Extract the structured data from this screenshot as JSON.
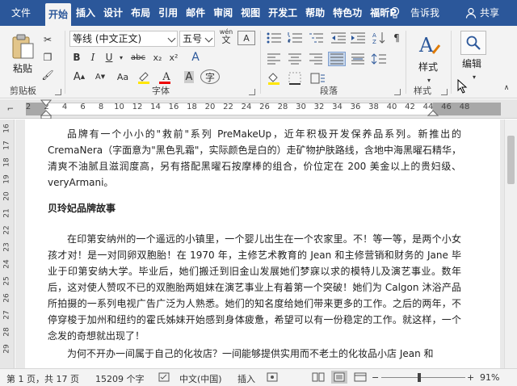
{
  "tabs": [
    "文件",
    "开始",
    "插入",
    "设计",
    "布局",
    "引用",
    "邮件",
    "审阅",
    "视图",
    "开发工",
    "帮助",
    "特色功",
    "福昕P"
  ],
  "active_tab": "开始",
  "tab_right": {
    "tellme": "告诉我",
    "share": "共享"
  },
  "clipboard": {
    "paste": "粘贴",
    "label": "剪贴板"
  },
  "font": {
    "name": "等线 (中文正文)",
    "size": "五号",
    "wen": "wén",
    "label": "字体",
    "bold": "B",
    "italic": "I",
    "underline": "U",
    "strike": "abc",
    "sub": "x₂",
    "sup": "x²",
    "font_color_a": "A",
    "aa_big": "A",
    "aa_small": "A",
    "aa": "Aa",
    "char": "A",
    "circ": "字",
    "clear": "A"
  },
  "paragraph": {
    "label": "段落"
  },
  "styles": {
    "button": "样式",
    "label": "样式"
  },
  "editing": {
    "button": "编辑"
  },
  "ruler": {
    "numbers": [
      "2",
      "2",
      "4",
      "6",
      "8",
      "10",
      "12",
      "14",
      "16",
      "18",
      "20",
      "22",
      "24",
      "26",
      "28",
      "30",
      "32",
      "34",
      "36",
      "38",
      "40",
      "42",
      "44",
      "46",
      "48"
    ]
  },
  "vruler": {
    "numbers": [
      "16",
      "17",
      "18",
      "19",
      "20",
      "21",
      "22",
      "23",
      "24",
      "25",
      "26",
      "27",
      "28",
      "29"
    ]
  },
  "document": {
    "p1": "品牌有一个小小的\"救前\"系列 PreMakeUp，近年积极开发保养品系列。新推出的 CremaNera（字面意为\"黑色乳霜\"，实际颜色是白的）走矿物护肤路线，含地中海黑曜石精华，清爽不油腻且滋润度高，另有搭配黑曜石按摩棒的组合，价位定在 200 美金以上的贵妇级、veryArmani。",
    "heading": "贝玲妃品牌故事",
    "p2": "在印第安纳州的一个遥远的小镇里，一个婴儿出生在一个农家里。不！等一等，是两个小女孩才对！是一对同卵双胞胎！在 1970 年，主修艺术教育的 Jean 和主修营销和财务的 Jane 毕业于印第安纳大学。毕业后，她们搬迁到旧金山发展她们梦寐以求的模特儿及演艺事业。数年后，这对使人赞叹不已的双胞胎两姐妹在演艺事业上有着第一个突破！她们为 Calgon 沐浴产品所拍摄的一系列电视广告广泛为人熟悉。她们的知名度给她们带来更多的工作。之后的两年，不停穿梭于加州和纽约的霍氏姊妹开始感到身体疲惫，希望可以有一份稳定的工作。就这样，一个念发的奇想就出现了！",
    "p3": "为何不开办一间属于自己的化妆店？一间能够提供实用而不老土的化妆品小店 Jean 和"
  },
  "status": {
    "page": "第 1 页，共 17 页",
    "words": "15209 个字",
    "lang": "中文(中国)",
    "mode": "插入",
    "zoom": "91%",
    "zoom_level": 0.91
  }
}
